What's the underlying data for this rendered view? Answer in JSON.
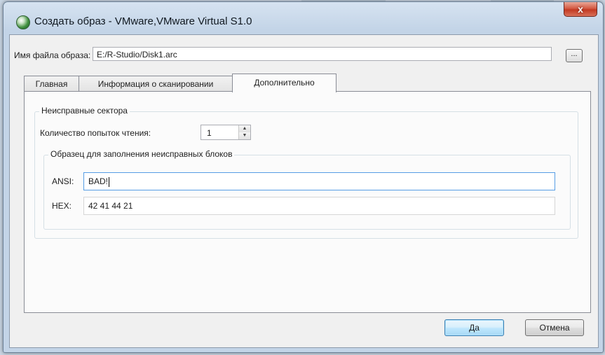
{
  "window": {
    "title": "Создать образ - VMware,VMware Virtual S1.0",
    "close_glyph": "x",
    "icon": "r-studio-app-icon"
  },
  "filename": {
    "label": "Имя файла образа:",
    "value": "E:/R-Studio/Disk1.arc",
    "browse_label": "..."
  },
  "tabs": [
    {
      "label": "Главная",
      "active": false
    },
    {
      "label": "Информация о сканировании",
      "active": false
    },
    {
      "label": "Дополнительно",
      "active": true
    }
  ],
  "bad_sectors": {
    "group_title": "Неисправные сектора",
    "read_attempts_label": "Количество попыток чтения:",
    "read_attempts_value": "1",
    "pattern_group_title": "Образец для заполнения неисправных блоков",
    "ansi_label": "ANSI:",
    "ansi_value": "BAD!",
    "hex_label": "HEX:",
    "hex_value": "42 41 44 21"
  },
  "buttons": {
    "ok_label": "Да",
    "cancel_label": "Отмена"
  },
  "colors": {
    "focus_border": "#569de5",
    "default_button": "#bee6fd",
    "close_button": "#c33a23"
  }
}
